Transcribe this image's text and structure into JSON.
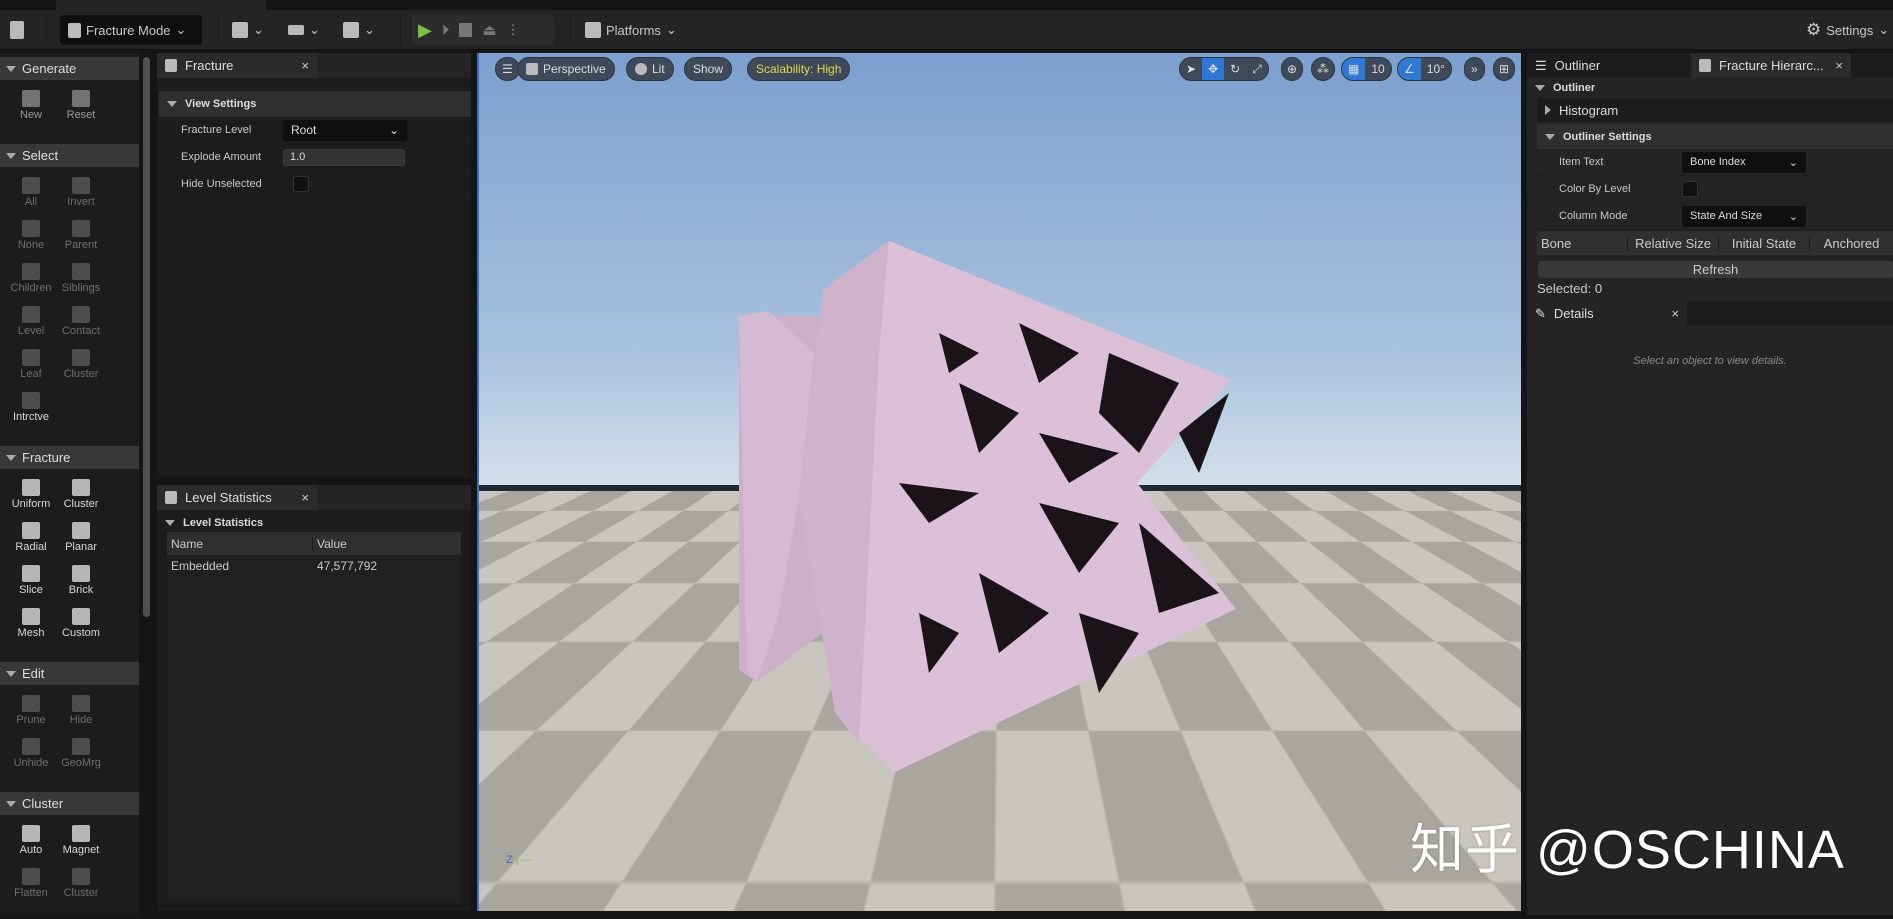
{
  "toolbar": {
    "mode": "Fracture Mode",
    "platforms": "Platforms",
    "settings": "Settings"
  },
  "left_tools": [
    {
      "title": "Generate",
      "tools": [
        "New",
        "Reset"
      ]
    },
    {
      "title": "Select",
      "tools": [
        "All",
        "Invert",
        "None",
        "Parent",
        "Children",
        "Siblings",
        "Level",
        "Contact",
        "Leaf",
        "Cluster",
        "Intrctve"
      ]
    },
    {
      "title": "Fracture",
      "tools": [
        "Uniform",
        "Cluster",
        "Radial",
        "Planar",
        "Slice",
        "Brick",
        "Mesh",
        "Custom"
      ]
    },
    {
      "title": "Edit",
      "tools": [
        "Prune",
        "Hide",
        "Unhide",
        "GeoMrg"
      ]
    },
    {
      "title": "Cluster",
      "tools": [
        "Auto",
        "Magnet",
        "Flatten",
        "Cluster"
      ]
    }
  ],
  "fracture_panel": {
    "tab": "Fracture",
    "category": "View Settings",
    "rows": [
      {
        "label": "Fracture Level",
        "value": "Root"
      },
      {
        "label": "Explode Amount",
        "value": "1.0"
      },
      {
        "label": "Hide Unselected",
        "value": ""
      }
    ]
  },
  "level_stats": {
    "tab": "Level Statistics",
    "category": "Level Statistics",
    "columns": [
      "Name",
      "Value"
    ],
    "rows": [
      {
        "name": "Embedded",
        "value": "47,577,792"
      }
    ]
  },
  "viewport": {
    "perspective": "Perspective",
    "lit": "Lit",
    "show": "Show",
    "scalability": "Scalability: High",
    "grid_snap": "10",
    "rot_snap": "10°",
    "axis": "Z"
  },
  "outliner": {
    "tab": "Outliner",
    "tab2": "Fracture Hierarc...",
    "section": "Outliner",
    "histogram": "Histogram",
    "settings": "Outliner Settings",
    "rows": [
      {
        "label": "Item Text",
        "value": "Bone Index"
      },
      {
        "label": "Color By Level",
        "value": ""
      },
      {
        "label": "Column Mode",
        "value": "State And Size"
      }
    ],
    "columns": [
      "Bone",
      "Relative Size",
      "Initial State",
      "Anchored"
    ],
    "refresh": "Refresh",
    "selected": "Selected: 0"
  },
  "details": {
    "tab": "Details",
    "empty": "Select an object to view details."
  },
  "watermark": "知乎 @OSCHINA",
  "colors": {
    "accent": "#2f78d4",
    "play": "#7cc242",
    "scalability": "#e8d44a",
    "object": "#d8bcd6"
  }
}
